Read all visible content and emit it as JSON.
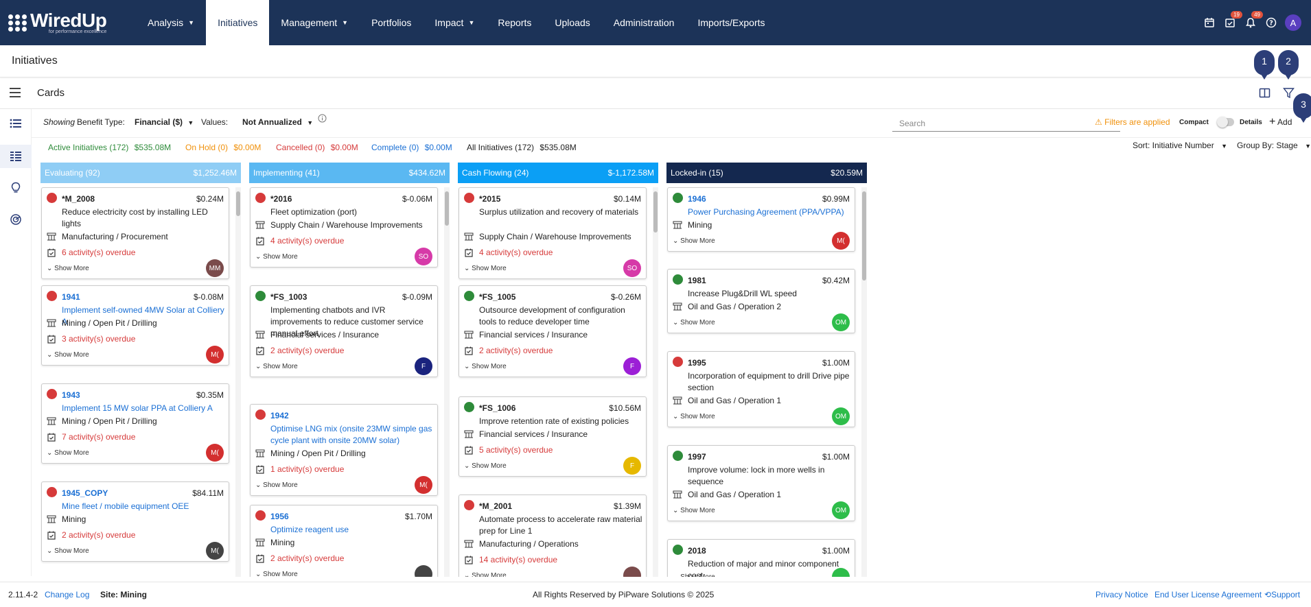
{
  "app": {
    "logo_text": "WiredUp",
    "logo_tagline": "for performance excellence"
  },
  "nav": [
    {
      "label": "Analysis",
      "dropdown": true
    },
    {
      "label": "Initiatives",
      "dropdown": false,
      "active": true
    },
    {
      "label": "Management",
      "dropdown": true
    },
    {
      "label": "Portfolios",
      "dropdown": false
    },
    {
      "label": "Impact",
      "dropdown": true
    },
    {
      "label": "Reports",
      "dropdown": false
    },
    {
      "label": "Uploads",
      "dropdown": false
    },
    {
      "label": "Administration",
      "dropdown": false
    },
    {
      "label": "Imports/Exports",
      "dropdown": false
    }
  ],
  "nav_right": {
    "tasks_badge": "19",
    "notifications_badge": "49",
    "user_initial": "A"
  },
  "page": {
    "title": "Initiatives",
    "subtitle": "Cards"
  },
  "markers": [
    "1",
    "2",
    "3"
  ],
  "filters": {
    "showing_label": "Showing",
    "benefit_type_label": "Benefit Type:",
    "benefit_type_value": "Financial ($)",
    "values_label": "Values:",
    "values_value": "Not Annualized",
    "search_placeholder": "Search",
    "filters_applied": "Filters are applied",
    "compact_label": "Compact",
    "details_label": "Details",
    "add_label": "Add",
    "sort_label": "Sort: Initiative Number",
    "group_label": "Group By: Stage"
  },
  "summary": [
    {
      "label": "Active Initiatives (172)",
      "value": "$535.08M",
      "color": "#2e8b3a"
    },
    {
      "label": "On Hold (0)",
      "value": "$0.00M",
      "color": "#f0900a"
    },
    {
      "label": "Cancelled (0)",
      "value": "$0.00M",
      "color": "#d63a3a"
    },
    {
      "label": "Complete (0)",
      "value": "$0.00M",
      "color": "#1a6fd4"
    },
    {
      "label": "All Initiatives (172)",
      "value": "$535.08M",
      "color": "#222222"
    }
  ],
  "columns": [
    {
      "title": "Evaluating (92)",
      "total": "$1,252.46M",
      "color": "#8fcdf5",
      "cards": [
        {
          "id": "*M_2008",
          "value": "$0.24M",
          "status": "#d63a3a",
          "link": false,
          "title": "Reduce electricity cost by installing LED lights",
          "category": "Manufacturing / Procurement",
          "overdue": "6 activity(s) overdue",
          "avatar": "MM",
          "avatar_color": "#7a4b4b"
        },
        {
          "id": "1941",
          "value": "$-0.08M",
          "status": "#d63a3a",
          "link": true,
          "title": "Implement self-owned 4MW Solar at Colliery A",
          "category": "Mining / Open Pit / Drilling",
          "overdue": "3 activity(s) overdue",
          "avatar": "M(",
          "avatar_color": "#d32f2f"
        },
        {
          "id": "1943",
          "value": "$0.35M",
          "status": "#d63a3a",
          "link": true,
          "title": "Implement 15 MW solar PPA at Colliery A",
          "category": "Mining / Open Pit / Drilling",
          "overdue": "7 activity(s) overdue",
          "avatar": "M(",
          "avatar_color": "#d32f2f"
        },
        {
          "id": "1945_COPY",
          "value": "$84.11M",
          "status": "#d63a3a",
          "link": true,
          "title": "Mine fleet / mobile equipment OEE",
          "category": "Mining",
          "overdue": "2 activity(s) overdue",
          "avatar": "M(",
          "avatar_color": "#444444"
        }
      ]
    },
    {
      "title": "Implementing (41)",
      "total": "$434.62M",
      "color": "#5ab8f2",
      "cards": [
        {
          "id": "*2016",
          "value": "$-0.06M",
          "status": "#d63a3a",
          "link": false,
          "title": "Fleet optimization (port)",
          "category": "Supply Chain / Warehouse Improvements",
          "overdue": "4 activity(s) overdue",
          "avatar": "SO",
          "avatar_color": "#d63aa8"
        },
        {
          "id": "*FS_1003",
          "value": "$-0.09M",
          "status": "#2e8b3a",
          "link": false,
          "title": "Implementing chatbots and IVR improvements to reduce customer service manual effort",
          "category": "Financial services / Insurance",
          "overdue": "2 activity(s) overdue",
          "avatar": "F",
          "avatar_color": "#1a237e"
        },
        {
          "id": "1942",
          "value": "",
          "status": "#d63a3a",
          "link": true,
          "title": "Optimise LNG mix (onsite 23MW simple gas cycle plant with onsite 20MW solar)",
          "category": "Mining / Open Pit / Drilling",
          "overdue": "1 activity(s) overdue",
          "avatar": "M(",
          "avatar_color": "#d32f2f"
        },
        {
          "id": "1956",
          "value": "$1.70M",
          "status": "#d63a3a",
          "link": true,
          "title": "Optimize reagent use",
          "category": "Mining",
          "overdue": "2 activity(s) overdue",
          "avatar": "",
          "avatar_color": "#444444"
        }
      ]
    },
    {
      "title": "Cash Flowing (24)",
      "total": "$-1,172.58M",
      "color": "#0b9ff5",
      "cards": [
        {
          "id": "*2015",
          "value": "$0.14M",
          "status": "#d63a3a",
          "link": false,
          "title": "Surplus utilization and recovery of materials",
          "category": "Supply Chain / Warehouse Improvements",
          "overdue": "4 activity(s) overdue",
          "avatar": "SO",
          "avatar_color": "#d63aa8"
        },
        {
          "id": "*FS_1005",
          "value": "$-0.26M",
          "status": "#2e8b3a",
          "link": false,
          "title": "Outsource development of configuration tools to reduce developer time",
          "category": "Financial services / Insurance",
          "overdue": "2 activity(s) overdue",
          "avatar": "F",
          "avatar_color": "#9c1fd6"
        },
        {
          "id": "*FS_1006",
          "value": "$10.56M",
          "status": "#2e8b3a",
          "link": false,
          "title": "Improve retention rate of existing policies",
          "category": "Financial services / Insurance",
          "overdue": "5 activity(s) overdue",
          "avatar": "F",
          "avatar_color": "#e6b800"
        },
        {
          "id": "*M_2001",
          "value": "$1.39M",
          "status": "#d63a3a",
          "link": false,
          "title": "Automate process to accelerate raw material prep for Line 1",
          "category": "Manufacturing / Operations",
          "overdue": "14 activity(s) overdue",
          "avatar": "",
          "avatar_color": "#7a4b4b"
        }
      ]
    },
    {
      "title": "Locked-in (15)",
      "total": "$20.59M",
      "color": "#14284f",
      "cards": [
        {
          "id": "1946",
          "value": "$0.99M",
          "status": "#2e8b3a",
          "link": true,
          "title": "Power Purchasing Agreement (PPA/VPPA)",
          "category": "Mining",
          "overdue": "",
          "avatar": "M(",
          "avatar_color": "#d32f2f"
        },
        {
          "id": "1981",
          "value": "$0.42M",
          "status": "#2e8b3a",
          "link": false,
          "title": "Increase Plug&Drill WL speed",
          "category": "Oil and Gas / Operation 2",
          "overdue": "",
          "avatar": "OM",
          "avatar_color": "#2ebd4a"
        },
        {
          "id": "1995",
          "value": "$1.00M",
          "status": "#d63a3a",
          "link": false,
          "title": "Incorporation of equipment to drill Drive pipe section",
          "category": "Oil and Gas / Operation 1",
          "overdue": "",
          "avatar": "OM",
          "avatar_color": "#2ebd4a"
        },
        {
          "id": "1997",
          "value": "$1.00M",
          "status": "#2e8b3a",
          "link": false,
          "title": "Improve volume: lock in more wells in sequence",
          "category": "Oil and Gas / Operation 1",
          "overdue": "",
          "avatar": "OM",
          "avatar_color": "#2ebd4a"
        },
        {
          "id": "2018",
          "value": "$1.00M",
          "status": "#2e8b3a",
          "link": false,
          "title": "Reduction of major and minor component cost",
          "category": "",
          "overdue": "",
          "avatar": "",
          "avatar_color": "#2ebd4a"
        }
      ]
    }
  ],
  "show_more": "Show More",
  "footer": {
    "version": "2.11.4-2",
    "changelog": "Change Log",
    "site": "Site: Mining",
    "copyright": "All Rights Reserved by PiPware Solutions © 2025",
    "privacy": "Privacy Notice",
    "eula": "End User License Agreement",
    "support": "Support"
  }
}
